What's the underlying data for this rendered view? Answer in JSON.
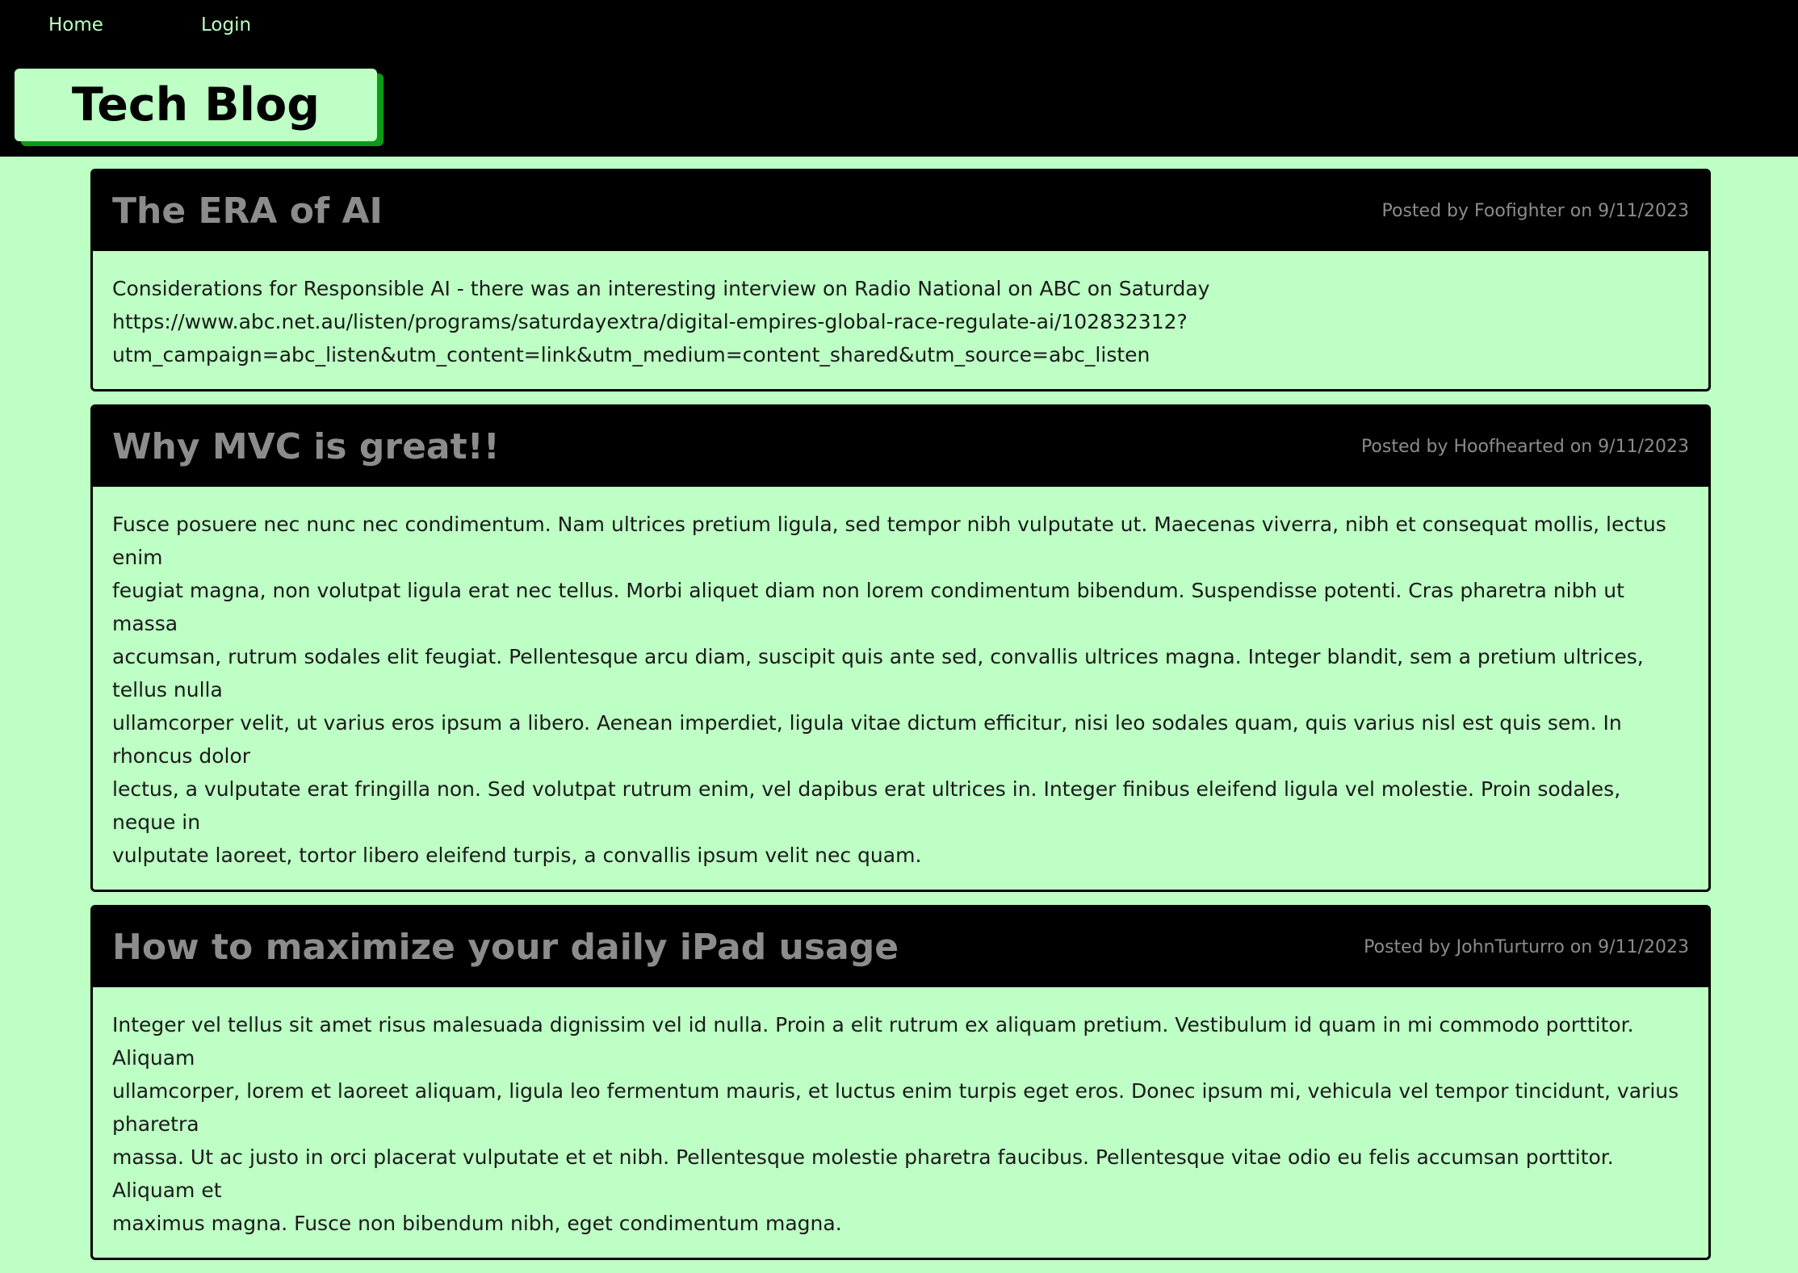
{
  "nav": {
    "home": "Home",
    "login": "Login"
  },
  "brand": {
    "title": "Tech Blog"
  },
  "posts": [
    {
      "title": "The ERA of AI",
      "author": "Foofighter",
      "date": "9/11/2023",
      "meta": "Posted by Foofighter on 9/11/2023",
      "body_lines": [
        "Considerations for Responsible AI - there was an interesting interview on Radio National on ABC on Saturday",
        "https://www.abc.net.au/listen/programs/saturdayextra/digital-empires-global-race-regulate-ai/102832312?",
        "utm_campaign=abc_listen&utm_content=link&utm_medium=content_shared&utm_source=abc_listen"
      ]
    },
    {
      "title": "Why MVC is great!!",
      "author": "Hoofhearted",
      "date": "9/11/2023",
      "meta": "Posted by Hoofhearted on 9/11/2023",
      "body_lines": [
        "Fusce posuere nec nunc nec condimentum. Nam ultrices pretium ligula, sed tempor nibh vulputate ut. Maecenas viverra, nibh et consequat mollis, lectus enim",
        "feugiat magna, non volutpat ligula erat nec tellus. Morbi aliquet diam non lorem condimentum bibendum. Suspendisse potenti. Cras pharetra nibh ut massa",
        "accumsan, rutrum sodales elit feugiat. Pellentesque arcu diam, suscipit quis ante sed, convallis ultrices magna. Integer blandit, sem a pretium ultrices, tellus nulla",
        "ullamcorper velit, ut varius eros ipsum a libero. Aenean imperdiet, ligula vitae dictum efficitur, nisi leo sodales quam, quis varius nisl est quis sem. In rhoncus dolor",
        "lectus, a vulputate erat fringilla non. Sed volutpat rutrum enim, vel dapibus erat ultrices in. Integer finibus eleifend ligula vel molestie. Proin sodales, neque in",
        "vulputate laoreet, tortor libero eleifend turpis, a convallis ipsum velit nec quam."
      ]
    },
    {
      "title": "How to maximize your daily iPad usage",
      "author": "JohnTurturro",
      "date": "9/11/2023",
      "meta": "Posted by JohnTurturro on 9/11/2023",
      "body_lines": [
        "Integer vel tellus sit amet risus malesuada dignissim vel id nulla. Proin a elit rutrum ex aliquam pretium. Vestibulum id quam in mi commodo porttitor. Aliquam",
        "ullamcorper, lorem et laoreet aliquam, ligula leo fermentum mauris, et luctus enim turpis eget eros. Donec ipsum mi, vehicula vel tempor tincidunt, varius pharetra",
        "massa. Ut ac justo in orci placerat vulputate et et nibh. Pellentesque molestie pharetra faucibus. Pellentesque vitae odio eu felis accumsan porttitor. Aliquam et",
        "maximus magna. Fusce non bibendum nibh, eget condimentum magna."
      ]
    }
  ],
  "colors": {
    "background": "#bdffc4",
    "header": "#000000",
    "shadow": "#0d9a16",
    "muted_text": "#8c8c8c"
  }
}
